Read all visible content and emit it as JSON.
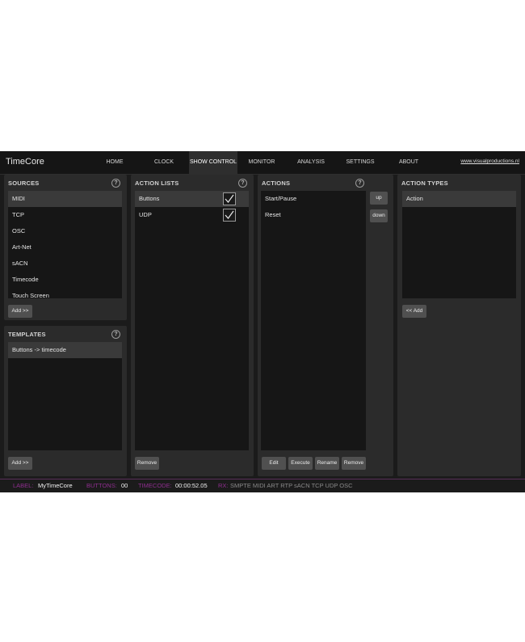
{
  "app": {
    "title": "TimeCore",
    "site_link": "www.visualproductions.nl"
  },
  "nav": {
    "tabs": [
      {
        "label": "HOME"
      },
      {
        "label": "CLOCK"
      },
      {
        "label": "SHOW CONTROL"
      },
      {
        "label": "MONITOR"
      },
      {
        "label": "ANALYSIS"
      },
      {
        "label": "SETTINGS"
      },
      {
        "label": "ABOUT"
      }
    ],
    "active": "SHOW CONTROL"
  },
  "help_icon": "?",
  "sources": {
    "title": "SOURCES",
    "items": [
      "MIDI",
      "TCP",
      "OSC",
      "Art-Net",
      "sACN",
      "Timecode",
      "Touch Screen"
    ],
    "selected": "MIDI",
    "add_label": "Add >>"
  },
  "templates": {
    "title": "TEMPLATES",
    "items": [
      "Buttons -> timecode"
    ],
    "selected": "Buttons -> timecode",
    "add_label": "Add >>"
  },
  "action_lists": {
    "title": "ACTION LISTS",
    "items": [
      {
        "label": "Buttons",
        "checked": true
      },
      {
        "label": "UDP",
        "checked": true
      }
    ],
    "selected": "Buttons",
    "remove_label": "Remove"
  },
  "actions": {
    "title": "ACTIONS",
    "items": [
      "Start/Pause",
      "Reset"
    ],
    "up_label": "up",
    "down_label": "down",
    "edit_label": "Edit",
    "execute_label": "Execute",
    "rename_label": "Rename",
    "remove_label": "Remove"
  },
  "action_types": {
    "title": "ACTION TYPES",
    "items": [
      "Action"
    ],
    "selected": "Action",
    "add_label": "<< Add"
  },
  "status": {
    "label_key": "LABEL:",
    "label_val": "MyTimeCore",
    "buttons_key": "BUTTONS:",
    "buttons_val": "00",
    "timecode_key": "TIMECODE:",
    "timecode_val": "00:00:52.05",
    "rx_key": "RX:",
    "rx_items": "SMPTE MIDI ART RTP sACN TCP UDP OSC"
  },
  "colors": {
    "accent": "#8e2e8e",
    "background": "#1b1b1b",
    "panel": "#2b2b2b",
    "list": "#161616"
  }
}
